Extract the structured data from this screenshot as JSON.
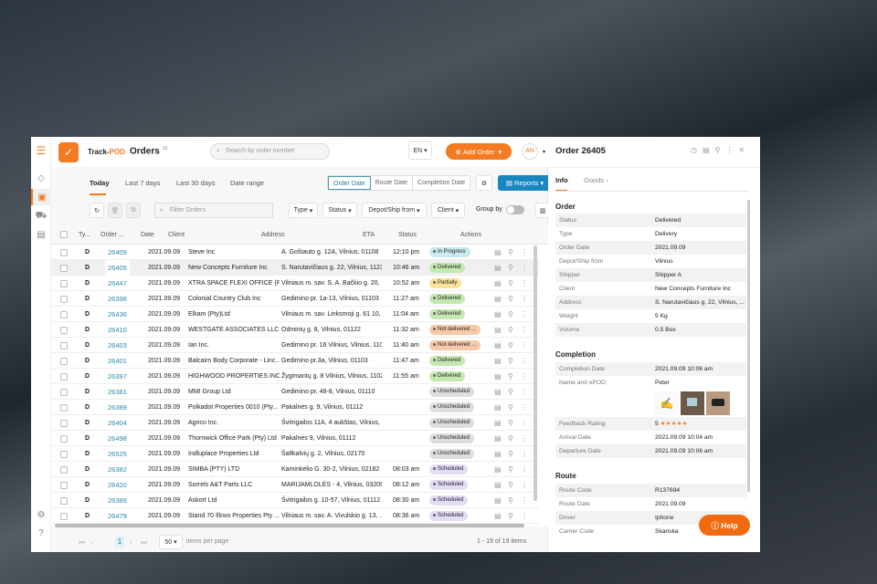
{
  "header": {
    "brand_a": "Track-",
    "brand_b": "POD",
    "title": "Orders",
    "count": "19",
    "search_placeholder": "Search by order number",
    "lang": "EN",
    "add_order": "Add Order",
    "avatar": "AN"
  },
  "tabs": [
    "Today",
    "Last 7 days",
    "Last 30 days",
    "Date range"
  ],
  "date_modes": [
    "Order Date",
    "Route Date",
    "Completion Date"
  ],
  "reports": "Reports",
  "filters": {
    "placeholder": "Filter Orders",
    "type": "Type",
    "status": "Status",
    "depot": "Depot/Ship from",
    "client": "Client",
    "group_by": "Group by"
  },
  "columns": [
    "Ty...",
    "Order ...",
    "Date",
    "Client",
    "Address",
    "ETA",
    "Status",
    "Actions"
  ],
  "status_colors": {
    "In Progress": "#c8eaf0",
    "Delivered": "#c5e8b0",
    "Partially": "#fbe39a",
    "Not delivered ...": "#f6c9a8",
    "Unscheduled": "#dedede",
    "Scheduled": "#e5dbf5"
  },
  "rows": [
    [
      "D",
      "26409",
      "2021.09.09",
      "Steve Inc",
      "A. Goštauto g. 12A, Vilnius, 01108",
      "12:10 pm",
      "In Progress"
    ],
    [
      "D",
      "26405",
      "2021.09.09",
      "New Concepts Furniture Inc",
      "S. Narutavičiaus g. 22, Vilnius, 11239",
      "10:46 am",
      "Delivered"
    ],
    [
      "D",
      "26447",
      "2021.09.09",
      "XTRA SPACE FLEXI OFFICE (P...",
      "Vilniaus m. sav. S. A. Bačkio g. 20, ...",
      "10:52 am",
      "Partially"
    ],
    [
      "D",
      "26398",
      "2021.09.09",
      "Colonial Country Club Inc",
      "Gedimino pr. 1a-13, Vilnius, 01103",
      "11:27 am",
      "Delivered"
    ],
    [
      "D",
      "26436",
      "2021.09.09",
      "Elkam (Pty)Ltd",
      "Vilniaus m. sav. Linksmoji g. 61 10, ...",
      "11:04 am",
      "Delivered"
    ],
    [
      "D",
      "26410",
      "2021.09.09",
      "WESTGATE ASSOCIATES LLC R",
      "Odminių g. 8, Vilnius, 01122",
      "11:32 am",
      "Not delivered ..."
    ],
    [
      "D",
      "26403",
      "2021.09.09",
      "Ian Inc.",
      "Gedimino pr. 16 Vilnius, Vilnius, 1103",
      "11:40 am",
      "Not delivered ..."
    ],
    [
      "D",
      "26401",
      "2021.09.09",
      "Balcairn Body Corporate - Linc...",
      "Gedimino pr.3a, Vilnius, 01103",
      "11:47 am",
      "Delivered"
    ],
    [
      "D",
      "26397",
      "2021.09.09",
      "HIGHWOOD PROPERTIES INC",
      "Žygimantų g. 8 Vilnius, Vilnius, 1102",
      "11:55 am",
      "Delivered"
    ],
    [
      "D",
      "26381",
      "2021.09.09",
      "MMI Group Ltd",
      "Gedimino pr, 48-8, Vilnius, 01110",
      "",
      "Unscheduled"
    ],
    [
      "D",
      "26389",
      "2021.09.09",
      "Polkadot Properties 0010 (Pty...",
      "Pakalnės g. 9, Vilnius, 01112",
      "",
      "Unscheduled"
    ],
    [
      "D",
      "26404",
      "2021.09.09",
      "Agrico Inc.",
      "Švitrigailos 11A, 4 aukštas, Vilnius, ...",
      "",
      "Unscheduled"
    ],
    [
      "D",
      "26498",
      "2021.09.09",
      "Thornwick Office Park (Pty) Ltd",
      "Pakalnės 9, Vilnius, 01112",
      "",
      "Unscheduled"
    ],
    [
      "D",
      "26525",
      "2021.09.09",
      "Indluplace Properties Ltd",
      "Šaltkalvių g. 2, Vilnius, 02170",
      "",
      "Unscheduled"
    ],
    [
      "D",
      "26382",
      "2021.09.09",
      "SIMBA (PTY) LTD",
      "Kaminkelio G. 30-2, Vilnius, 02182",
      "08:03 am",
      "Scheduled"
    ],
    [
      "D",
      "26420",
      "2021.09.09",
      "Sorrels A&T Parts LLC",
      "MARIJAMLOLĖS - 4, Vilnius, 03209",
      "08:12 am",
      "Scheduled"
    ],
    [
      "D",
      "26389",
      "2021.09.09",
      "Askort Ltd",
      "Švitrigailos g. 10-57, Vilnius, 01112",
      "08:30 am",
      "Scheduled"
    ],
    [
      "D",
      "26479",
      "2021.09.09",
      "Stand 70 Illovo Properties Pty ...",
      "Vilniaus m. sav. A. Vivulskio g. 13, ...",
      "08:36 am",
      "Scheduled"
    ]
  ],
  "pager": {
    "page": "1",
    "per_page": "50",
    "per_page_label": "items per page",
    "summary": "1 - 19 of 19 items"
  },
  "panel": {
    "title": "Order 26405",
    "tabs": [
      "Info",
      "Goods ›"
    ],
    "order_title": "Order",
    "order": [
      [
        "Status",
        "Delivered"
      ],
      [
        "Type",
        "Delivery"
      ],
      [
        "Order Date",
        "2021.09.09"
      ],
      [
        "Depot/Ship from",
        "Vilnius"
      ],
      [
        "Shipper",
        "Shipper A"
      ],
      [
        "Client",
        "New Concepts Furniture Inc"
      ],
      [
        "Address",
        "S. Narutavičiaus g. 22, Vilnius, ..."
      ],
      [
        "Weight",
        "5 Kg"
      ],
      [
        "Volume",
        "0.5 Box"
      ]
    ],
    "completion_title": "Completion",
    "completion": [
      [
        "Completion Date",
        "2021.09.09 10:06 am"
      ],
      [
        "Name and ePOD",
        "Peter"
      ]
    ],
    "rating_label": "Feedback Rating",
    "rating": "5",
    "rating_stars": 5,
    "completion2": [
      [
        "Arrival Date",
        "2021.09.09 10:04 am"
      ],
      [
        "Departure Date",
        "2021.09.09 10:06 am"
      ]
    ],
    "route_title": "Route",
    "route": [
      [
        "Route Code",
        "R137694"
      ],
      [
        "Route Date",
        "2021.09.09"
      ],
      [
        "Driver",
        "Iphone"
      ],
      [
        "Carrier Code",
        "Skanska"
      ]
    ],
    "help": "Help"
  }
}
